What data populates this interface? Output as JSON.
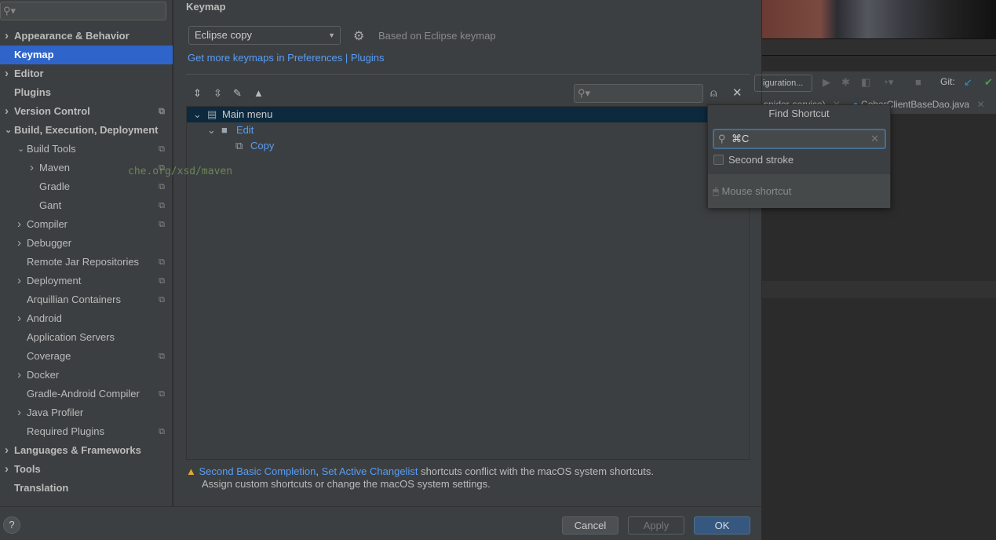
{
  "sidebar": {
    "search_placeholder": "",
    "items": [
      {
        "label": "Appearance & Behavior",
        "level": 0,
        "arrow": "collapsed",
        "copy": false
      },
      {
        "label": "Keymap",
        "level": 0,
        "arrow": "none",
        "copy": false,
        "selected": true
      },
      {
        "label": "Editor",
        "level": 0,
        "arrow": "collapsed",
        "copy": false
      },
      {
        "label": "Plugins",
        "level": 0,
        "arrow": "none",
        "copy": false
      },
      {
        "label": "Version Control",
        "level": 0,
        "arrow": "collapsed",
        "copy": true
      },
      {
        "label": "Build, Execution, Deployment",
        "level": 0,
        "arrow": "expanded",
        "copy": false
      },
      {
        "label": "Build Tools",
        "level": 1,
        "arrow": "expanded",
        "copy": true
      },
      {
        "label": "Maven",
        "level": 2,
        "arrow": "collapsed",
        "copy": true
      },
      {
        "label": "Gradle",
        "level": 2,
        "arrow": "none",
        "copy": true
      },
      {
        "label": "Gant",
        "level": 2,
        "arrow": "none",
        "copy": true
      },
      {
        "label": "Compiler",
        "level": 1,
        "arrow": "collapsed",
        "copy": true
      },
      {
        "label": "Debugger",
        "level": 1,
        "arrow": "collapsed",
        "copy": false
      },
      {
        "label": "Remote Jar Repositories",
        "level": 1,
        "arrow": "none",
        "copy": true
      },
      {
        "label": "Deployment",
        "level": 1,
        "arrow": "collapsed",
        "copy": true
      },
      {
        "label": "Arquillian Containers",
        "level": 1,
        "arrow": "none",
        "copy": true
      },
      {
        "label": "Android",
        "level": 1,
        "arrow": "collapsed",
        "copy": false
      },
      {
        "label": "Application Servers",
        "level": 1,
        "arrow": "none",
        "copy": false
      },
      {
        "label": "Coverage",
        "level": 1,
        "arrow": "none",
        "copy": true
      },
      {
        "label": "Docker",
        "level": 1,
        "arrow": "collapsed",
        "copy": false
      },
      {
        "label": "Gradle-Android Compiler",
        "level": 1,
        "arrow": "none",
        "copy": true
      },
      {
        "label": "Java Profiler",
        "level": 1,
        "arrow": "collapsed",
        "copy": false
      },
      {
        "label": "Required Plugins",
        "level": 1,
        "arrow": "none",
        "copy": true
      },
      {
        "label": "Languages & Frameworks",
        "level": 0,
        "arrow": "collapsed",
        "copy": false
      },
      {
        "label": "Tools",
        "level": 0,
        "arrow": "collapsed",
        "copy": false
      },
      {
        "label": "Translation",
        "level": 0,
        "arrow": "none",
        "copy": false
      }
    ]
  },
  "main": {
    "title": "Keymap",
    "keymap_select": "Eclipse copy",
    "based_on": "Based on Eclipse keymap",
    "get_more_link": "Get more keymaps in Preferences | Plugins",
    "tree": [
      {
        "label": "Main menu",
        "level": 0,
        "icon": "menu-icon"
      },
      {
        "label": "Edit",
        "level": 1,
        "icon": "folder-icon"
      },
      {
        "label": "Copy",
        "level": 2,
        "icon": "copy-icon"
      }
    ],
    "warning": {
      "link1": "Second Basic Completion",
      "sep": ", ",
      "link2": "Set Active Changelist",
      "text1": " shortcuts conflict with the macOS system shortcuts.",
      "text2": "Assign custom shortcuts or change the macOS system settings."
    }
  },
  "footer": {
    "help": "?",
    "cancel": "Cancel",
    "apply": "Apply",
    "ok": "OK"
  },
  "find_shortcut": {
    "title": "Find Shortcut",
    "value": "⌘C",
    "second_stroke": "Second stroke",
    "mouse_shortcut": "Mouse shortcut"
  },
  "ide": {
    "run_config": "iguration...",
    "git_label": "Git:",
    "tab1": "-spider-service)",
    "tab2": "CobarClientBaseDao.java",
    "code": "che.org/xsd/maven"
  },
  "colors": {
    "accent": "#2f65ca",
    "link": "#589df6",
    "ok": "#365880"
  }
}
